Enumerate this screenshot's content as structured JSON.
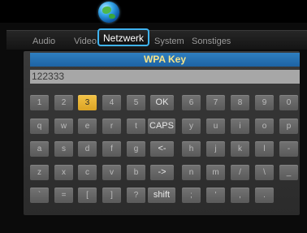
{
  "tabs": [
    {
      "label": "Audio"
    },
    {
      "label": "Video"
    },
    {
      "label": "Netzwerk"
    },
    {
      "label": "System"
    },
    {
      "label": "Sonstiges"
    }
  ],
  "active_tab": "Netzwerk",
  "dialog": {
    "title": "WPA Key",
    "input_value": "122333"
  },
  "keyboard": {
    "selected_key": "3",
    "rows": [
      [
        "1",
        "2",
        "3",
        "4",
        "5",
        "OK",
        "6",
        "7",
        "8",
        "9",
        "0"
      ],
      [
        "q",
        "w",
        "e",
        "r",
        "t",
        "CAPS",
        "y",
        "u",
        "i",
        "o",
        "p"
      ],
      [
        "a",
        "s",
        "d",
        "f",
        "g",
        "<-",
        "h",
        "j",
        "k",
        "l",
        "-"
      ],
      [
        "z",
        "x",
        "c",
        "v",
        "b",
        "->",
        "n",
        "m",
        "/",
        "\\",
        "_"
      ],
      [
        "`",
        "=",
        "[",
        "]",
        "?",
        "shift",
        ";",
        "'",
        ",",
        "."
      ]
    ]
  },
  "colors": {
    "accent_blue": "#3fb3f0",
    "title_bar": "#2270b0",
    "title_text": "#f4e38a",
    "selected_key": "#f3c347"
  }
}
